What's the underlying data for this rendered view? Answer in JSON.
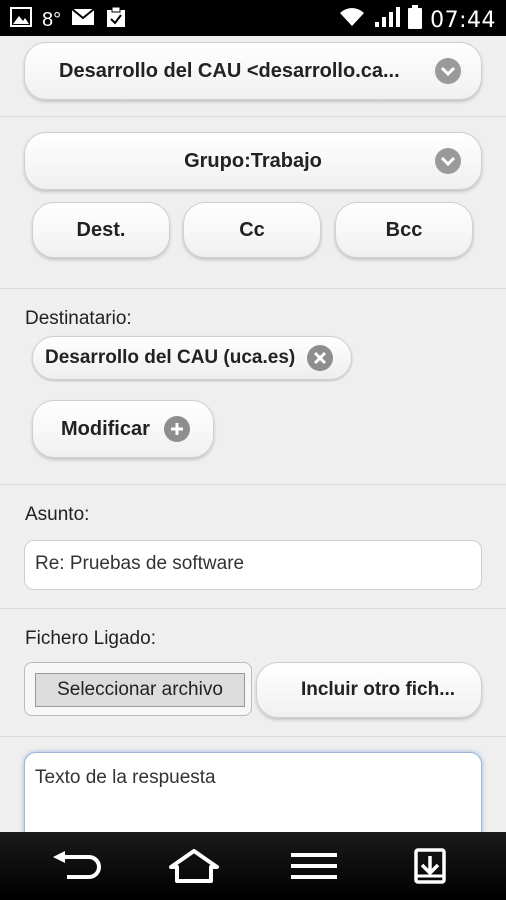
{
  "status_bar": {
    "notification": "8°",
    "time": "07:44",
    "icons": [
      "image-icon",
      "mail-icon",
      "clipboard-icon",
      "wifi-icon",
      "signal-icon",
      "battery-icon"
    ]
  },
  "from": {
    "selected": "Desarrollo del CAU <desarrollo.ca..."
  },
  "group": {
    "selected": "Grupo:Trabajo",
    "buttons": {
      "dest": "Dest.",
      "cc": "Cc",
      "bcc": "Bcc"
    }
  },
  "recipient": {
    "label": "Destinatario:",
    "tag": "Desarrollo del CAU (uca.es)",
    "modify": "Modificar"
  },
  "subject": {
    "label": "Asunto:",
    "value": "Re: Pruebas de software"
  },
  "attachment": {
    "label": "Fichero Ligado:",
    "choose": "Seleccionar archivo",
    "include": "Incluir otro fich..."
  },
  "body": {
    "placeholder": "Texto de la respuesta"
  },
  "nav_bar": {
    "icons": [
      "back-icon",
      "home-icon",
      "menu-icon",
      "download-icon"
    ]
  }
}
